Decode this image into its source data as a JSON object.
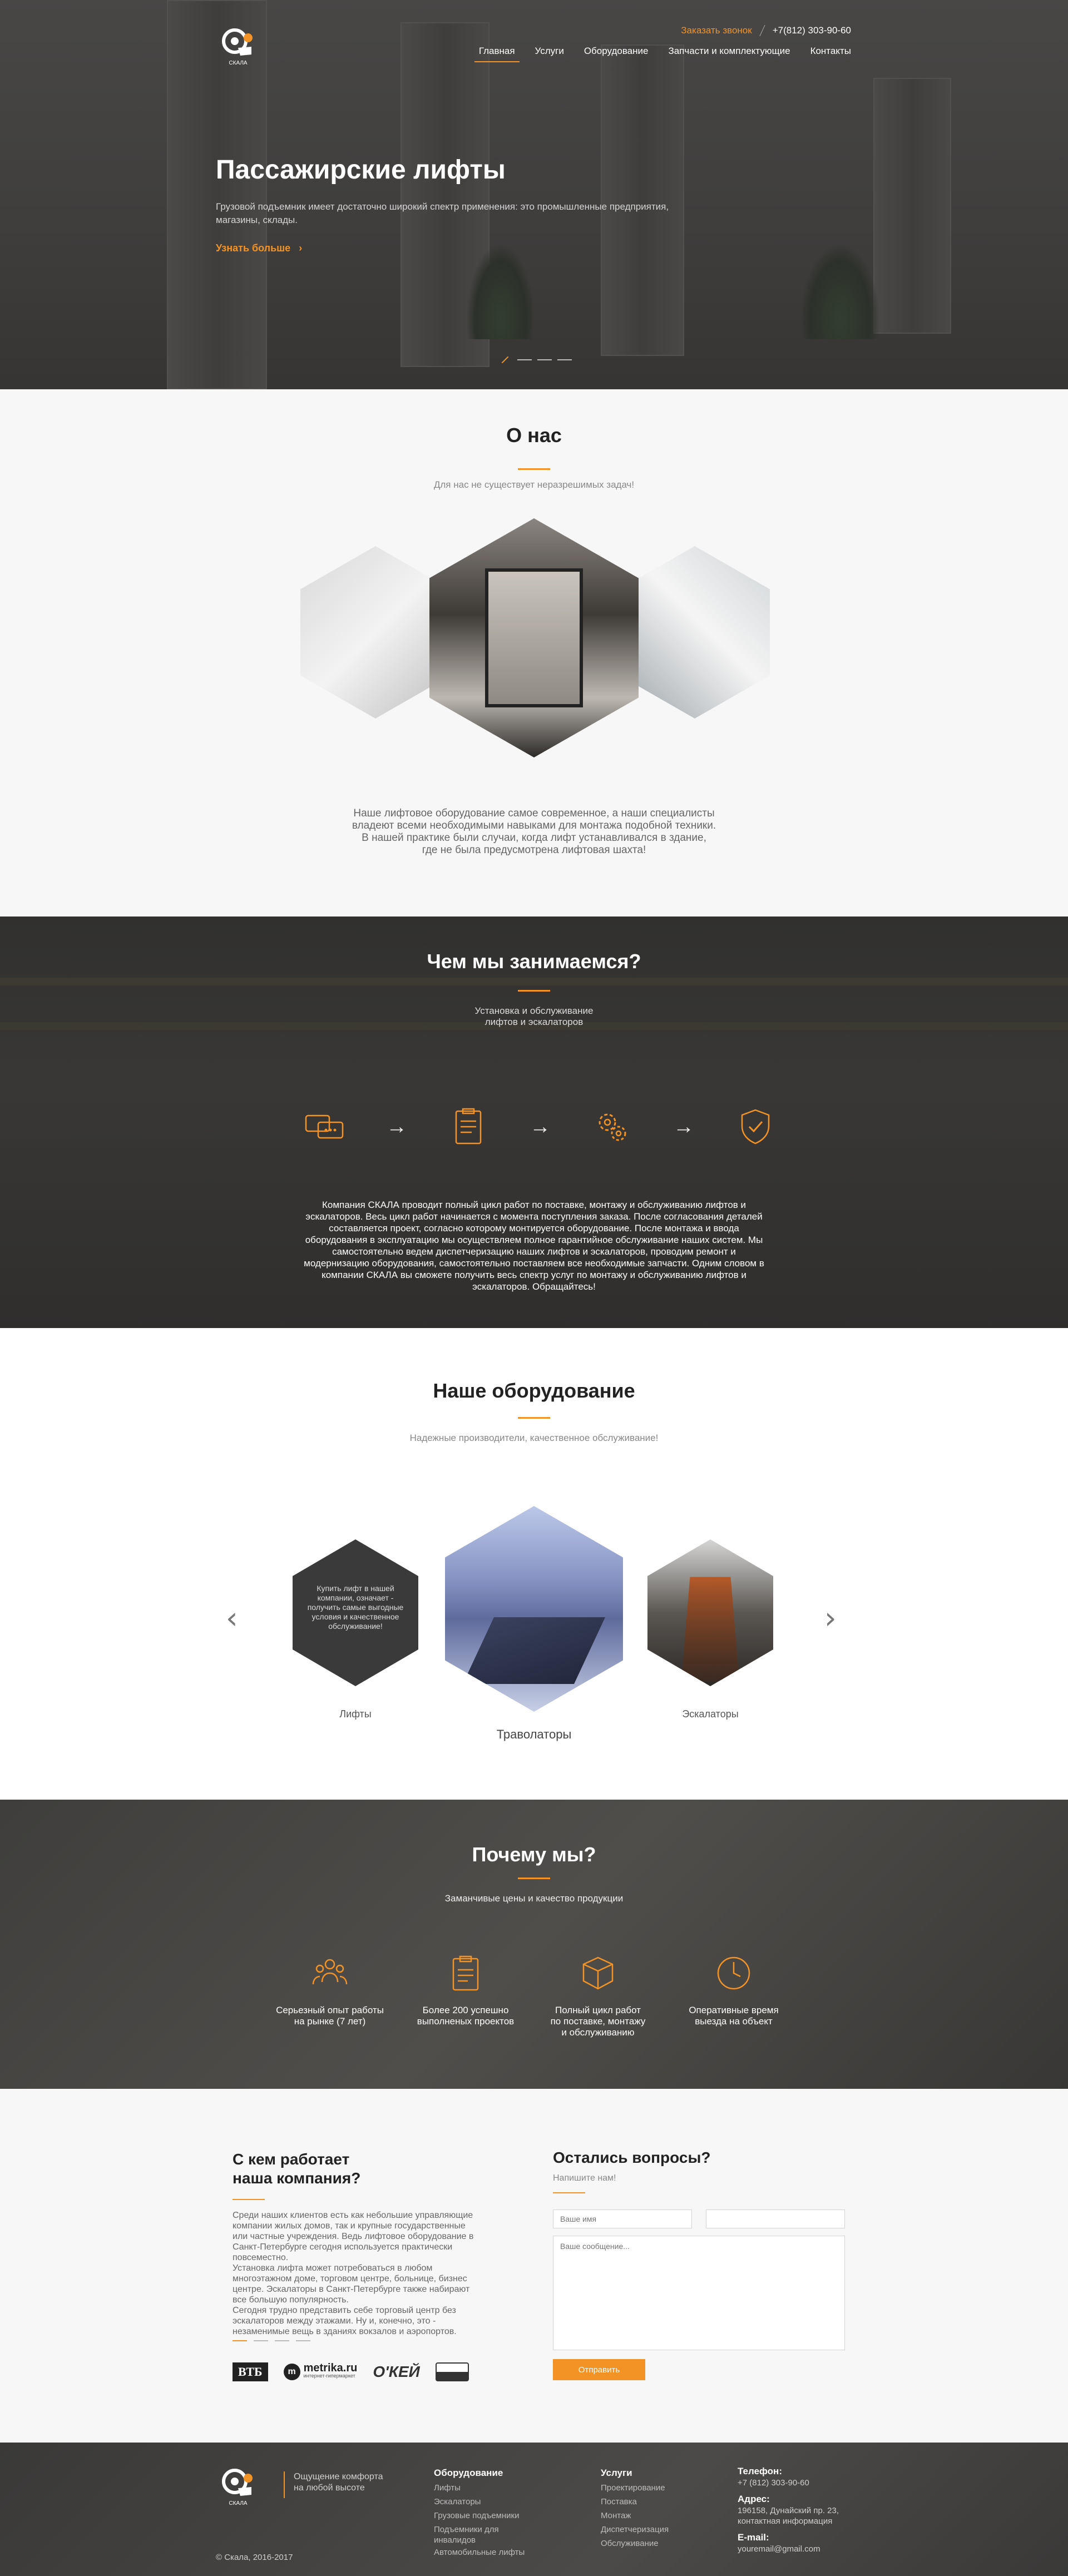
{
  "header": {
    "callback": "Заказать звонок",
    "phone": "+7(812) 303-90-60",
    "nav": [
      "Главная",
      "Услуги",
      "Оборудование",
      "Запчасти и комплектующие",
      "Контакты"
    ]
  },
  "hero": {
    "title": "Пассажирские лифты",
    "text": "Грузовой подъемник имеет достаточно широкий спектр применения: это промышленные предприятия, магазины, склады.",
    "more": "Узнать больше"
  },
  "about": {
    "title": "О нас",
    "subtitle": "Для нас не существует неразрешимых задач!",
    "text": [
      "Наше лифтовое оборудование самое современное, а наши специалисты",
      "владеют всеми необходимыми навыками для монтажа подобной техники.",
      "В нашей практике были случаи, когда лифт устанавливался в здание,",
      "где не была предусмотрена лифтовая шахта!"
    ]
  },
  "services": {
    "title": "Чем мы занимаемся?",
    "subtitle": [
      "Установка и обслуживание",
      "лифтов и эскалаторов"
    ],
    "icons": [
      "chat-icon",
      "document-icon",
      "gears-icon",
      "shield-icon"
    ],
    "text": [
      "Компания СКАЛА проводит полный цикл работ по поставке, монтажу и обслуживанию лифтов и",
      "эскалаторов. Весь цикл работ начинается с момента поступления заказа. После согласования деталей",
      "составляется проект, согласно которому монтируется оборудование. После монтажа и ввода",
      "оборудования в эксплуатацию мы осуществляем полное гарантийное обслуживание наших систем. Мы",
      "самостоятельно ведем диспетчеризацию наших лифтов и эскалаторов, проводим ремонт и",
      "модернизацию оборудования, самостоятельно поставляем все необходимые запчасти. Одним словом в",
      "компании СКАЛА вы сможете получить весь спектр услуг по монтажу и обслуживанию лифтов и",
      "эскалаторов. Обращайтесь!"
    ]
  },
  "equipment": {
    "title": "Наше оборудование",
    "subtitle": "Надежные производители, качественное обслуживание!",
    "items": [
      {
        "label": "Лифты",
        "overlay": [
          "Купить лифт в нашей",
          "компании, означает -",
          "получить самые выгодные",
          "условия и качественное",
          "обслуживание!"
        ]
      },
      {
        "label": "Траволаторы"
      },
      {
        "label": "Эскалаторы"
      }
    ]
  },
  "why": {
    "title": "Почему мы?",
    "subtitle": "Заманчивые цены и качество продукции",
    "items": [
      {
        "icon": "team-icon",
        "text": [
          "Серьезный опыт работы",
          "на рынке (7 лет)"
        ]
      },
      {
        "icon": "clipboard-icon",
        "text": [
          "Более 200 успешно",
          "выполненых проектов"
        ]
      },
      {
        "icon": "box-icon",
        "text": [
          "Полный цикл работ",
          "по поставке, монтажу",
          "и обслуживанию"
        ]
      },
      {
        "icon": "clock-icon",
        "text": [
          "Оперативные время",
          "выезда на объект"
        ]
      }
    ]
  },
  "clients": {
    "title": [
      "С кем работает",
      "наша компания?"
    ],
    "text": [
      "Среди наших клиентов есть как небольшие управляющие",
      "компании жилых домов, так и крупные государственные",
      "или частные учреждения. Ведь лифтовое оборудование в",
      "Санкт-Петербурге сегодня используется практически",
      "повсеместно.",
      "Установка лифта может потребоваться в любом",
      "многоэтажном доме, торговом центре, больнице, бизнес",
      "центре. Эскалаторы в Санкт-Петербурге также набирают",
      "все большую популярность.",
      "Сегодня трудно представить себе торговый центр без",
      "эскалаторов между этажами. Ну и, конечно, это -",
      "незаменимые вещь в зданиях вокзалов и аэропортов."
    ],
    "logos": {
      "vtb": "ВТБ",
      "metrika": "metrika.ru",
      "metrika_sub": "интернет-гипермаркет",
      "okey": "О'КЕЙ"
    }
  },
  "form": {
    "title": "Остались вопросы?",
    "subtitle": "Напишите нам!",
    "name_placeholder": "Ваше имя",
    "message_placeholder": "Ваше сообщение...",
    "submit": "Отправить"
  },
  "footer": {
    "slogan": [
      "Ощущение комфорта",
      "на любой высоте"
    ],
    "equipment_title": "Оборудование",
    "equipment": [
      "Лифты",
      "Эскалаторы",
      "Грузовые подъемники",
      "Подъемники для",
      "инвалидов",
      "Автомобильные лифты"
    ],
    "services_title": "Услуги",
    "services": [
      "Проектирование",
      "Поставка",
      "Монтаж",
      "Диспетчеризация",
      "Обслуживание"
    ],
    "phone_title": "Телефон:",
    "phone": "+7 (812) 303-90-60",
    "address_title": "Адрес:",
    "address": [
      "196158, Дунайский пр. 23,",
      "контактная информация"
    ],
    "email_title": "E-mail:",
    "email": "youremail@gmail.com",
    "copyright": "© Скала, 2016-2017"
  },
  "colors": {
    "accent": "#f39325",
    "dark": "#3f3e3c",
    "light_bg": "#f7f7f7"
  }
}
